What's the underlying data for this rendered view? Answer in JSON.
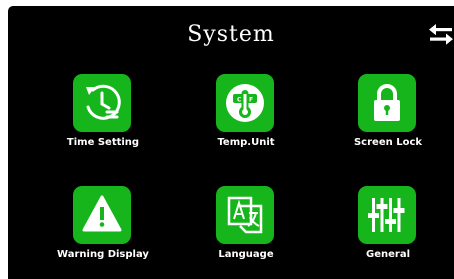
{
  "header": {
    "title": "System",
    "back_icon": "back-arrows-icon"
  },
  "tiles": [
    {
      "label": "Time Setting",
      "icon": "clock-history-icon"
    },
    {
      "label": "Temp.Unit",
      "icon": "thermometer-icon"
    },
    {
      "label": "Screen Lock",
      "icon": "padlock-icon"
    },
    {
      "label": "Warning Display",
      "icon": "warning-icon"
    },
    {
      "label": "Language",
      "icon": "translate-icon"
    },
    {
      "label": "General",
      "icon": "sliders-icon"
    }
  ],
  "colors": {
    "background": "#000000",
    "accent": "#16b51b",
    "text": "#ffffff"
  }
}
